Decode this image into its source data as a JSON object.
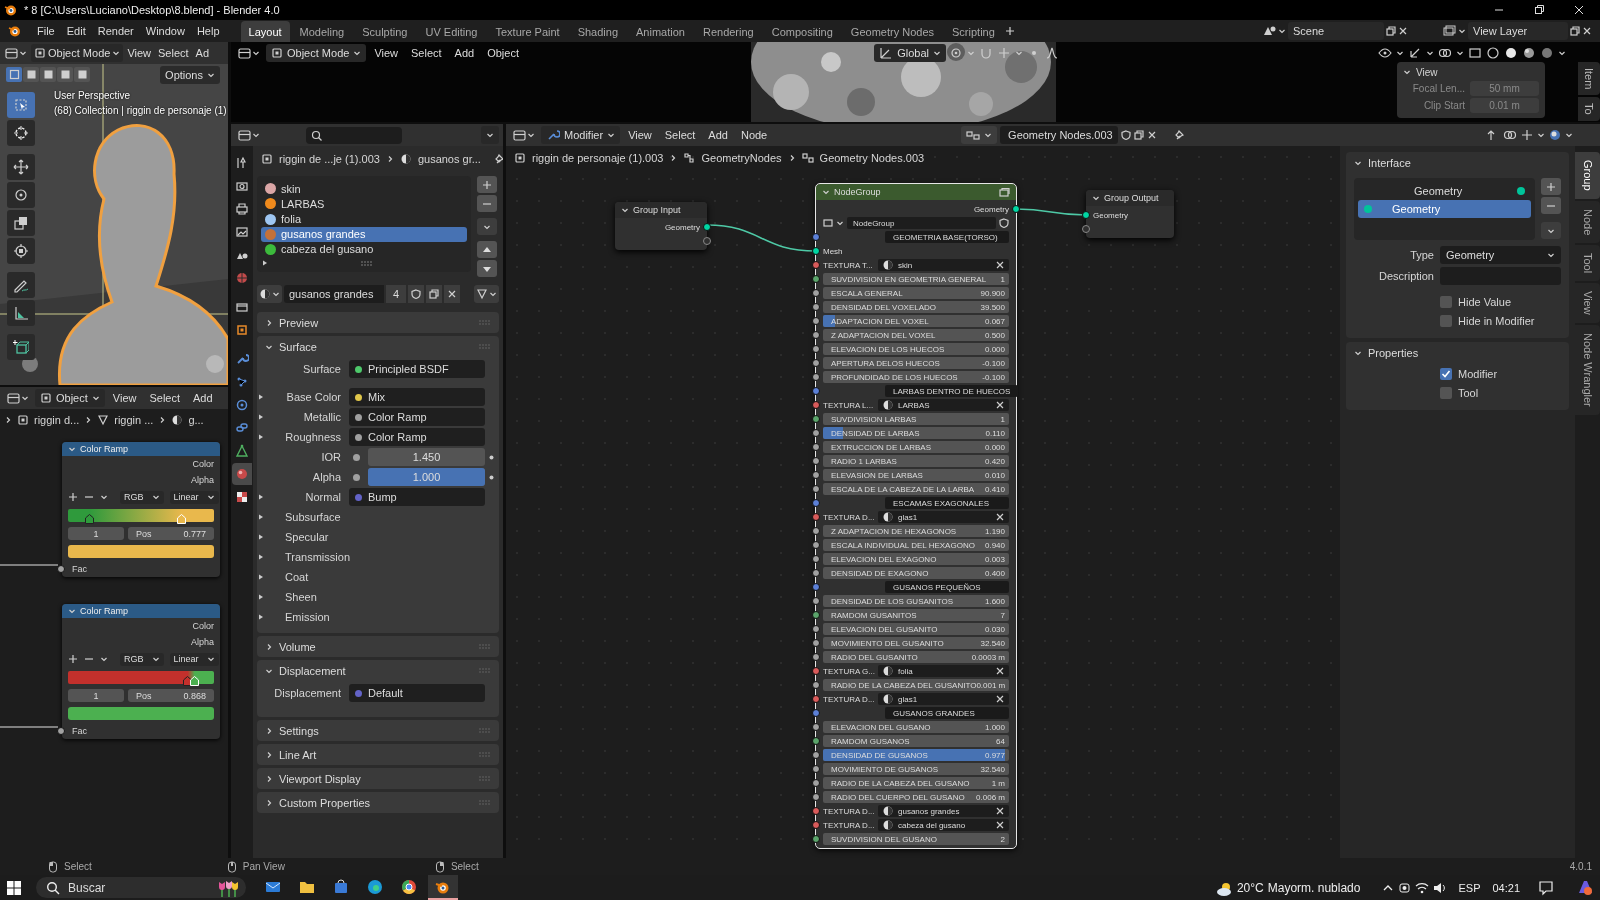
{
  "window": {
    "title": "* 8 [C:\\Users\\Luciano\\Desktop\\8.blend] - Blender 4.0"
  },
  "topbar": {
    "menus": [
      "File",
      "Edit",
      "Render",
      "Window",
      "Help"
    ],
    "workspaces": [
      {
        "label": "Layout",
        "selected": true
      },
      {
        "label": "Modeling",
        "selected": false
      },
      {
        "label": "Sculpting",
        "selected": false
      },
      {
        "label": "UV Editing",
        "selected": false
      },
      {
        "label": "Texture Paint",
        "selected": false
      },
      {
        "label": "Shading",
        "selected": false
      },
      {
        "label": "Animation",
        "selected": false
      },
      {
        "label": "Rendering",
        "selected": false
      },
      {
        "label": "Compositing",
        "selected": false
      },
      {
        "label": "Geometry Nodes",
        "selected": false
      },
      {
        "label": "Scripting",
        "selected": false
      }
    ],
    "scene": "Scene",
    "view_layer": "View Layer"
  },
  "viewport_left": {
    "mode": "Object Mode",
    "menus": [
      "View",
      "Select",
      "Ad"
    ],
    "options": "Options",
    "view_name": "User Perspective",
    "collection_info": "(68) Collection | riggin de personaje (1)",
    "select_modes": [
      {
        "selected": true
      },
      {
        "selected": false
      },
      {
        "selected": false
      },
      {
        "selected": false
      },
      {
        "selected": false
      }
    ],
    "tools": [
      {
        "selected": true
      },
      {
        "selected": false
      },
      {
        "selected": false
      },
      {
        "selected": false
      },
      {
        "selected": false
      },
      {
        "selected": false
      },
      {
        "selected": false
      },
      {
        "selected": false
      },
      {
        "selected": false
      }
    ]
  },
  "shader_editor": {
    "mode": "Object",
    "menus": [
      "View",
      "Select",
      "Add"
    ],
    "breadcrumb": [
      "riggin d...",
      "riggin ...",
      "g..."
    ],
    "nodes": [
      {
        "title": "Color Ramp",
        "outputs": [
          "Color",
          "Alpha"
        ],
        "color_mode": "RGB",
        "interpolation": "Linear",
        "stop_index": "1",
        "pos_label": "Pos",
        "pos_value": "0.777",
        "input": "Fac",
        "stops": [
          {
            "color": "#2f9a3c",
            "level": 0.15,
            "selected": false
          },
          {
            "color": "#e9b84c",
            "level": 0.78,
            "selected": true
          }
        ]
      },
      {
        "title": "Color Ramp",
        "outputs": [
          "Color",
          "Alpha"
        ],
        "color_mode": "RGB",
        "interpolation": "Linear",
        "stop_index": "1",
        "pos_label": "Pos",
        "pos_value": "0.868",
        "input": "Fac",
        "stops": [
          {
            "color": "#c3302c",
            "level": 0.82,
            "selected": false
          },
          {
            "color": "#4cb050",
            "level": 0.868,
            "selected": true
          }
        ]
      }
    ]
  },
  "viewport_main": {
    "mode": "Object Mode",
    "menus": [
      "View",
      "Select",
      "Add",
      "Object"
    ],
    "orientation": "Global",
    "view_panel": {
      "title": "View",
      "fields": [
        {
          "label": "Focal Len...",
          "value": "50 mm"
        },
        {
          "label": "Clip Start",
          "value": "0.01 m"
        }
      ]
    },
    "side_tabs": [
      "Item",
      "To"
    ]
  },
  "properties": {
    "tabs": [
      {
        "selected": false
      },
      {
        "selected": false
      },
      {
        "selected": false
      },
      {
        "selected": false
      },
      {
        "selected": false
      },
      {
        "selected": false
      },
      {
        "selected": false
      },
      {
        "selected": false
      },
      {
        "selected": false
      },
      {
        "selected": false
      },
      {
        "selected": false
      },
      {
        "selected": false
      },
      {
        "selected": false
      },
      {
        "selected": true
      },
      {
        "selected": false
      }
    ],
    "breadcrumb": [
      "riggin de ...je (1).003",
      "gusanos gr..."
    ],
    "material_slots": [
      {
        "name": "skin",
        "color": "#dba6a6",
        "selected": false
      },
      {
        "name": "LARBAS",
        "color": "#f08a1c",
        "selected": false
      },
      {
        "name": "folia",
        "color": "#9ec6f2",
        "selected": false
      },
      {
        "name": "gusanos grandes",
        "color": "#c4713a",
        "selected": true
      },
      {
        "name": "cabeza del gusano",
        "color": "#3cba3c",
        "selected": false
      }
    ],
    "material": {
      "name": "gusanos grandes",
      "users": "4"
    },
    "panels": [
      {
        "title": "Preview",
        "expanded": false
      },
      {
        "title": "Surface",
        "expanded": true,
        "rows": [
          {
            "kind": "link",
            "label": "Surface",
            "value": "Principled BSDF",
            "color": "#4ec96b",
            "expandable": false
          },
          {
            "kind": "link",
            "label": "Base Color",
            "value": "Mix",
            "color": "#e0c64a",
            "expandable": true
          },
          {
            "kind": "link",
            "label": "Metallic",
            "value": "Color Ramp",
            "color": "#a0a0a0",
            "expandable": true
          },
          {
            "kind": "link",
            "label": "Roughness",
            "value": "Color Ramp",
            "color": "#a0a0a0",
            "expandable": true
          },
          {
            "kind": "number",
            "label": "IOR",
            "value": "1.450",
            "color": "#a0a0a0"
          },
          {
            "kind": "slider",
            "label": "Alpha",
            "value": "1.000",
            "color": "#a0a0a0",
            "level": 1
          },
          {
            "kind": "link",
            "label": "Normal",
            "value": "Bump",
            "color": "#6363c7",
            "expandable": true
          },
          {
            "kind": "subpanel",
            "label": "Subsurface"
          },
          {
            "kind": "subpanel",
            "label": "Specular"
          },
          {
            "kind": "subpanel",
            "label": "Transmission"
          },
          {
            "kind": "subpanel",
            "label": "Coat"
          },
          {
            "kind": "subpanel",
            "label": "Sheen"
          },
          {
            "kind": "subpanel",
            "label": "Emission"
          }
        ]
      },
      {
        "title": "Volume",
        "expanded": false
      },
      {
        "title": "Displacement",
        "expanded": true,
        "rows": [
          {
            "kind": "link",
            "label": "Displacement",
            "value": "Default",
            "color": "#6363c7",
            "expandable": false
          }
        ]
      },
      {
        "title": "Settings",
        "expanded": false
      },
      {
        "title": "Line Art",
        "expanded": false
      },
      {
        "title": "Viewport Display",
        "expanded": false
      },
      {
        "title": "Custom Properties",
        "expanded": false
      }
    ]
  },
  "node_editor": {
    "editor": "Modifier",
    "menus": [
      "View",
      "Select",
      "Add",
      "Node"
    ],
    "tree": "Geometry Nodes.003",
    "breadcrumb": [
      "riggin de personaje (1).003",
      "GeometryNodes",
      "Geometry Nodes.003"
    ],
    "nodes": [
      {
        "kind": "group_input",
        "title": "Group Input",
        "sockets": [
          "Geometry"
        ]
      },
      {
        "kind": "group",
        "title": "NodeGroup",
        "rows": [
          {
            "kind": "output",
            "label": "Geometry"
          },
          {
            "kind": "group_select",
            "value": "NodeGroup"
          },
          {
            "kind": "panel",
            "label": "GEOMETRIA BASE(TORSO)"
          },
          {
            "kind": "input",
            "label": "Mesh"
          },
          {
            "kind": "texture",
            "label": "TEXTURA T...",
            "value": "skin"
          },
          {
            "kind": "int",
            "label": "SUVDIVISION EN GEOMETRIA GENERAL",
            "value": "1"
          },
          {
            "kind": "float",
            "label": "ESCALA GENERAL",
            "value": "90.900"
          },
          {
            "kind": "float",
            "label": "DENSIDAD DEL VOXELADO",
            "value": "39.500"
          },
          {
            "kind": "slider",
            "label": "ADAPTACION DEL VOXEL",
            "value": "0.067",
            "level": 0.067
          },
          {
            "kind": "float",
            "label": "Z ADAPTACION DEL VOXEL",
            "value": "0.500"
          },
          {
            "kind": "float",
            "label": "ELEVACION DE LOS HUECOS",
            "value": "0.000"
          },
          {
            "kind": "float",
            "label": "APERTURA DELOS HUECOS",
            "value": "-0.100"
          },
          {
            "kind": "float",
            "label": "PROFUNDIDAD DE LOS HUECOS",
            "value": "-0.100"
          },
          {
            "kind": "panel",
            "label": "LARBAS DENTRO DE HUECOS"
          },
          {
            "kind": "texture",
            "label": "TEXTURA L...",
            "value": "LARBAS"
          },
          {
            "kind": "int",
            "label": "SUVDIVISION LARBAS",
            "value": "1"
          },
          {
            "kind": "slider",
            "label": "DENSIDAD DE LARBAS",
            "value": "0.110",
            "level": 0.11
          },
          {
            "kind": "float",
            "label": "EXTRUCCION DE LARBAS",
            "value": "0.000"
          },
          {
            "kind": "float",
            "label": "RADIO 1 LARBAS",
            "value": "0.420"
          },
          {
            "kind": "float",
            "label": "ELEVASION DE LARBAS",
            "value": "0.010"
          },
          {
            "kind": "float",
            "label": "ESCALA DE LA CABEZA DE LA LARBA",
            "value": "0.410"
          },
          {
            "kind": "panel",
            "label": "ESCAMAS EXAGONALES"
          },
          {
            "kind": "texture",
            "label": "TEXTURA D...",
            "value": "glas1"
          },
          {
            "kind": "float",
            "label": "Z ADAPTACION DE HEXAGONOS",
            "value": "1.190"
          },
          {
            "kind": "float",
            "label": "ESCALA INDIVIDUAL DEL HEXAGONO",
            "value": "0.940"
          },
          {
            "kind": "float",
            "label": "ELEVACION DEL EXAGONO",
            "value": "0.003"
          },
          {
            "kind": "float",
            "label": "DENSIDAD DE EXAGONO",
            "value": "0.400"
          },
          {
            "kind": "panel",
            "label": "GUSANOS PEQUEÑOS"
          },
          {
            "kind": "float",
            "label": "DENSIDAD DE LOS GUSANITOS",
            "value": "1.600"
          },
          {
            "kind": "int",
            "label": "RAMDOM GUSANITOS",
            "value": "7"
          },
          {
            "kind": "float",
            "label": "ELEVACION DEL GUSANITO",
            "value": "0.030"
          },
          {
            "kind": "float",
            "label": "MOVIMIENTO DEL GUSANITO",
            "value": "32.540"
          },
          {
            "kind": "float",
            "label": "RADIO DEL GUSANITO",
            "value": "0.0003 m"
          },
          {
            "kind": "texture",
            "label": "TEXTURA G...",
            "value": "folia"
          },
          {
            "kind": "float",
            "label": "RADIO DE LA CABEZA DEL GUSANITO",
            "value": "0.001 m"
          },
          {
            "kind": "texture",
            "label": "TEXTURA D...",
            "value": "glas1"
          },
          {
            "kind": "panel",
            "label": "GUSANOS GRANDES"
          },
          {
            "kind": "float",
            "label": "ELEVACION DEL GUSANO",
            "value": "1.000"
          },
          {
            "kind": "int",
            "label": "RAMDOM GUSANOS",
            "value": "64"
          },
          {
            "kind": "slider",
            "label": "DENSIDAD DE GUSANOS",
            "value": "0.977",
            "level": 0.977
          },
          {
            "kind": "float",
            "label": "MOVIMIENTO DE GUSANOS",
            "value": "32.540"
          },
          {
            "kind": "float",
            "label": "RADIO DE LA CABEZA DEL GUSANO",
            "value": "1 m"
          },
          {
            "kind": "float",
            "label": "RADIO DEL CUERPO DEL GUSANO",
            "value": "0.006 m"
          },
          {
            "kind": "texture",
            "label": "TEXTURA D...",
            "value": "gusanos grandes"
          },
          {
            "kind": "texture",
            "label": "TEXTURA D...",
            "value": "cabeza del gusano"
          },
          {
            "kind": "int",
            "label": "SUVDIVISION DEL GUSANO",
            "value": "2"
          }
        ]
      },
      {
        "kind": "group_output",
        "title": "Group Output",
        "sockets": [
          "Geometry"
        ]
      }
    ],
    "sidebar": {
      "tabs": [
        {
          "label": "Group",
          "selected": true
        },
        {
          "label": "Node",
          "selected": false
        },
        {
          "label": "Tool",
          "selected": false
        },
        {
          "label": "View",
          "selected": false
        },
        {
          "label": "Node Wrangler",
          "selected": false
        }
      ],
      "interface": {
        "title": "Interface",
        "items": [
          {
            "name": "Geometry",
            "kind": "output",
            "selected": false
          },
          {
            "name": "Geometry",
            "kind": "input",
            "selected": true
          }
        ],
        "type_label": "Type",
        "type_value": "Geometry",
        "description_label": "Description",
        "checkboxes": [
          {
            "label": "Hide Value",
            "checked": false
          },
          {
            "label": "Hide in Modifier",
            "checked": false
          }
        ]
      },
      "properties": {
        "title": "Properties",
        "checkboxes": [
          {
            "label": "Modifier",
            "checked": true
          },
          {
            "label": "Tool",
            "checked": false
          }
        ]
      }
    }
  },
  "status_bar": {
    "hints": [
      "Select",
      "Pan View",
      "Select"
    ],
    "version": "4.0.1"
  },
  "taskbar": {
    "search": {
      "placeholder": "Buscar"
    },
    "apps": [
      {
        "selected": false
      },
      {
        "selected": false
      },
      {
        "selected": false
      },
      {
        "selected": false
      },
      {
        "selected": false
      },
      {
        "selected": true
      }
    ],
    "temperature": "20°C",
    "weather": "Mayorm. nublado",
    "language": "ESP",
    "time": "04:21"
  }
}
